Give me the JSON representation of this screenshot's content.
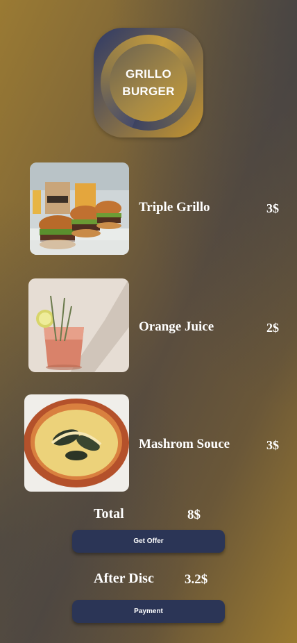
{
  "brand": {
    "line1": "GRILLO",
    "line2": "BURGER"
  },
  "menu": {
    "items": [
      {
        "name": "Triple Grillo",
        "price": "3$",
        "image": "burger-photo"
      },
      {
        "name": "Orange Juice",
        "price": "2$",
        "image": "drink-photo"
      },
      {
        "name": "Mashrom Souce",
        "price": "3$",
        "image": "sauce-photo"
      }
    ]
  },
  "summary": {
    "total_label": "Total",
    "total_value": "8$",
    "offer_button": "Get Offer",
    "after_label": "After Disc",
    "after_value": "3.2$",
    "payment_button": "Payment"
  },
  "colors": {
    "button": "#2b3556",
    "accent_gold": "#c49530",
    "accent_navy": "#2f3a66"
  }
}
